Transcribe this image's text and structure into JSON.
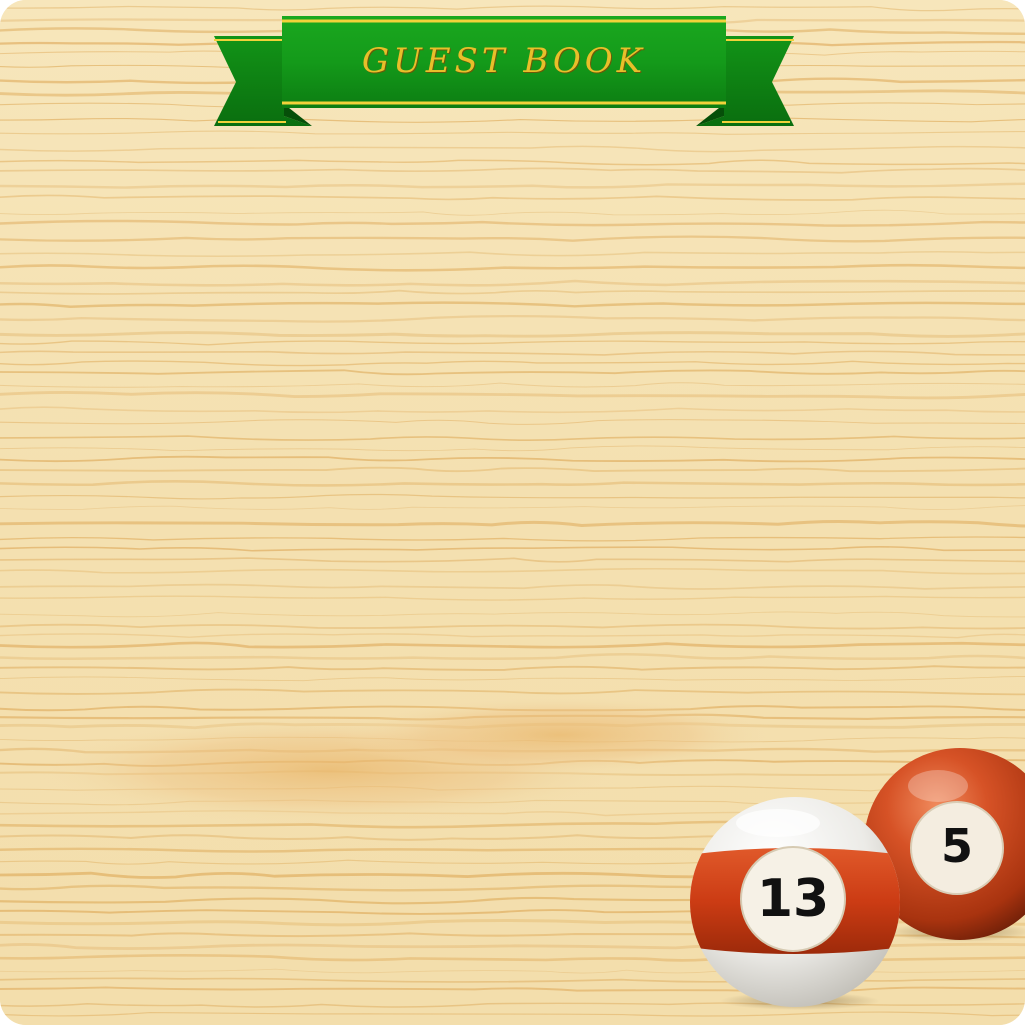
{
  "title": {
    "text": "GUEST BOOK"
  },
  "balls": [
    {
      "number": "5",
      "color": "#c0401a"
    },
    {
      "number": "13",
      "color": "#cc3c14"
    }
  ],
  "colors": {
    "wood": "#f5e3b5",
    "grain": "#e8b86a",
    "banner_green": "#149a1a",
    "banner_trim": "#f2d23a",
    "title_gold": "#e8bf2a"
  }
}
